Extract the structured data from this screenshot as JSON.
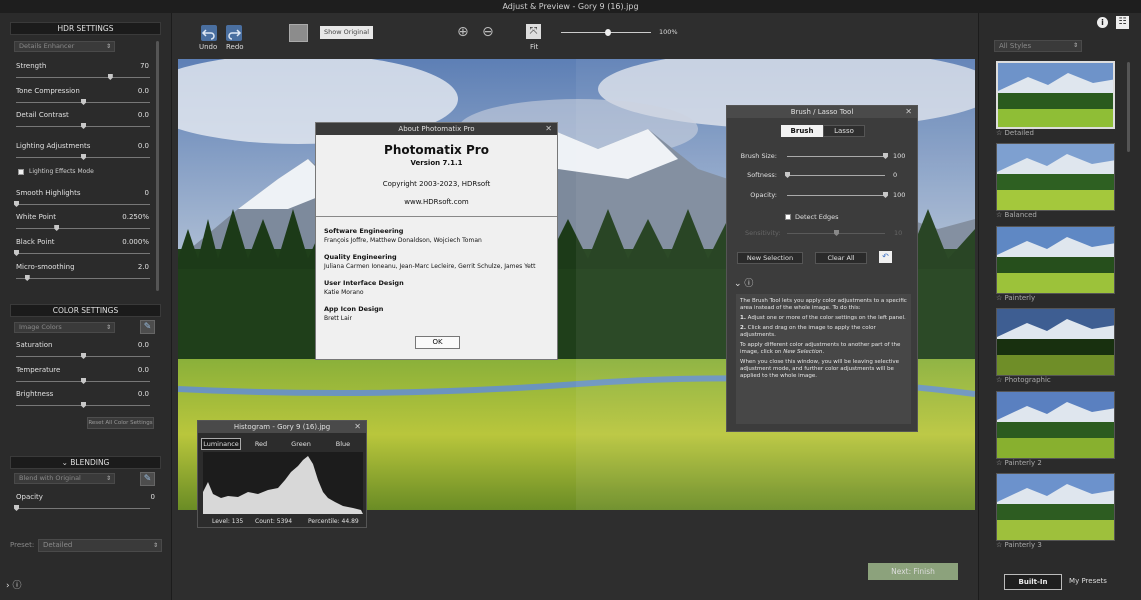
{
  "window": {
    "title": "Adjust & Preview - Gory 9 (16).jpg"
  },
  "hdr": {
    "header": "HDR SETTINGS",
    "method": "Details Enhancer",
    "sliders": [
      {
        "label": "Strength",
        "value": "70",
        "level": 0.7
      },
      {
        "label": "Tone Compression",
        "value": "0.0",
        "level": 0.5
      },
      {
        "label": "Detail Contrast",
        "value": "0.0",
        "level": 0.5
      },
      {
        "label": "Lighting Adjustments",
        "value": "0.0",
        "level": 0.5
      },
      {
        "label": "Smooth Highlights",
        "value": "0",
        "level": 0.0
      },
      {
        "label": "White Point",
        "value": "0.250%",
        "level": 0.3
      },
      {
        "label": "Black Point",
        "value": "0.000%",
        "level": 0.0
      },
      {
        "label": "Micro-smoothing",
        "value": "2.0",
        "level": 0.08
      }
    ],
    "lighting_mode_label": "Lighting Effects Mode"
  },
  "color": {
    "header": "COLOR SETTINGS",
    "preset": "Image Colors",
    "sliders": [
      {
        "label": "Saturation",
        "value": "0.0",
        "level": 0.5
      },
      {
        "label": "Temperature",
        "value": "0.0",
        "level": 0.5
      },
      {
        "label": "Brightness",
        "value": "0.0",
        "level": 0.5
      }
    ],
    "reset_label": "Reset All Color Settings"
  },
  "blending": {
    "header": "BLENDING",
    "mode": "Blend with Original",
    "opacity_label": "Opacity",
    "opacity_value": "0"
  },
  "presets": {
    "label": "Preset:",
    "value": "Detailed"
  },
  "toolbar": {
    "undo": "Undo",
    "redo": "Redo",
    "show_original": "Show Original",
    "fit": "Fit",
    "zoom": "100%"
  },
  "about": {
    "title": "About Photomatix Pro",
    "app_name": "Photomatix Pro",
    "version": "Version 7.1.1",
    "copyright": "Copyright 2003-2023, HDRsoft",
    "website": "www.HDRsoft.com",
    "sections": [
      {
        "heading": "Software Engineering",
        "names": "François Joffre, Matthew Donaldson, Wojciech Toman"
      },
      {
        "heading": "Quality Engineering",
        "names": "Juliana Carmen Ioneanu, Jean-Marc Lecleire, Gerrit Schulze, James Yett"
      },
      {
        "heading": "User Interface Design",
        "names": "Katie Morano"
      },
      {
        "heading": "App Icon Design",
        "names": "Brett Lair"
      }
    ],
    "ok": "OK"
  },
  "brush": {
    "title": "Brush / Lasso Tool",
    "tabs": [
      "Brush",
      "Lasso"
    ],
    "sliders": [
      {
        "label": "Brush Size:",
        "value": "100",
        "level": 1.0
      },
      {
        "label": "Softness:",
        "value": "0",
        "level": 0.0
      },
      {
        "label": "Opacity:",
        "value": "100",
        "level": 1.0
      }
    ],
    "detect_edges": "Detect Edges",
    "sensitivity": "Sensitivity:",
    "sensitivity_value": "10",
    "new_selection": "New Selection",
    "clear_all": "Clear All",
    "help_intro": "The Brush Tool lets you apply color adjustments to a specific area instead of the whole image. To do this:",
    "help_step1_num": "1.",
    "help_step1": "Adjust one or more of the color settings on the left panel.",
    "help_step2_num": "2.",
    "help_step2": "Click and drag on the image to apply the color adjustments.",
    "help_p2a": "To apply different color adjustments to another part of the image, click on ",
    "help_p2b": "New Selection",
    "help_p3": "When you close this window, you will be leaving selective adjustment mode, and further color adjustments will be applied to the whole image."
  },
  "histogram": {
    "title": "Histogram - Gory 9 (16).jpg",
    "tabs": [
      "Luminance",
      "Red",
      "Green",
      "Blue"
    ],
    "level": "Level: 135",
    "count": "Count: 5394",
    "percentile": "Percentile: 44.89"
  },
  "styles": {
    "filter": "All Styles",
    "items": [
      "Detailed",
      "Balanced",
      "Painterly",
      "Photographic",
      "Painterly 2",
      "Painterly 3"
    ],
    "tab_builtin": "Built-In",
    "tab_mypresets": "My Presets"
  },
  "footer": {
    "next": "Next: Finish"
  },
  "colors": {
    "accent": "#4a6fa0",
    "dialog_bg": "#f0f0f0",
    "panel_bg": "#2b2b2b"
  }
}
